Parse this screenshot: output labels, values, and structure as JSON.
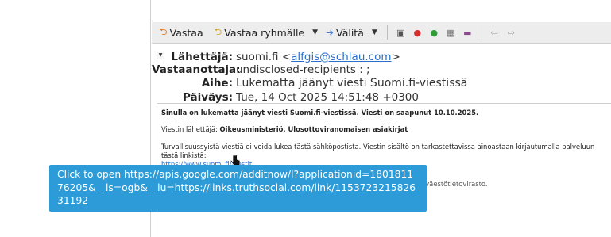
{
  "toolbar": {
    "reply_label": "Vastaa",
    "reply_all_label": "Vastaa ryhmälle",
    "forward_label": "Välitä",
    "icons": [
      "archive-icon",
      "junk-icon",
      "check-icon",
      "calendar-icon",
      "flag-icon",
      "back-icon",
      "forward-nav-icon"
    ]
  },
  "headers": {
    "from_label": "Lähettäjä:",
    "from_name": "suomi.fi <",
    "from_email": "alfgis@schlau.com",
    "from_close": ">",
    "to_label": "Vastaanottaja:",
    "to_value": "undisclosed-recipients : ;",
    "subject_label": "Aihe:",
    "subject_value": "Lukematta jäänyt viesti Suomi.fi-viestissä",
    "date_label": "Päiväys:",
    "date_value": "Tue, 14 Oct 2025 14:51:48 +0300"
  },
  "body": {
    "line1": "Sinulla on lukematta jäänyt viesti Suomi.fi-viestissä. Viesti on saapunut 10.10.2025.",
    "sender_label": "Viestin lähettäjä: ",
    "sender_value": "Oikeusministeriö, Ulosottoviranomaisen asiakirjat",
    "security_text": "Turvallisuussyistä viestiä ei voida lukea tästä sähköpostista. Viestin sisältö on tarkastettavissa ainoastaan kirjautumalla palveluun tästä linkistä:",
    "link_text": "https://www.suomi.fi/viestit",
    "partial_text": "Digi- ja väestötietovirasto."
  },
  "tooltip": {
    "text": "Click to open https://apis.google.com/additnow/l?applicationid=180181176205&__ls=ogb&__lu=https://links.truthsocial.com/link/115372321582631192"
  }
}
